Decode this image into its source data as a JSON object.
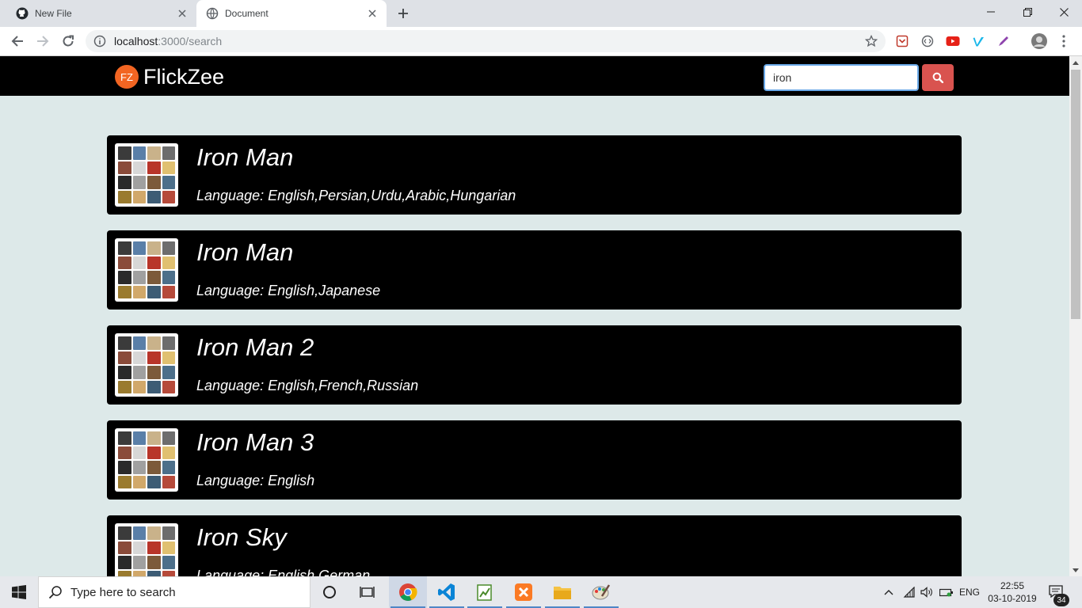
{
  "browser": {
    "tabs": [
      {
        "title": "New File",
        "icon": "github-icon",
        "active": false
      },
      {
        "title": "Document",
        "icon": "globe-icon",
        "active": true
      }
    ],
    "address": {
      "host": "localhost",
      "path": ":3000/search"
    }
  },
  "site": {
    "logo_badge": "FZ",
    "logo_text": "FlickZee",
    "search": {
      "value": "iron",
      "placeholder": ""
    }
  },
  "results": [
    {
      "title": "Iron Man",
      "language": "Language: English,Persian,Urdu,Arabic,Hungarian"
    },
    {
      "title": "Iron Man",
      "language": "Language: English,Japanese"
    },
    {
      "title": "Iron Man 2",
      "language": "Language: English,French,Russian"
    },
    {
      "title": "Iron Man 3",
      "language": "Language: English"
    },
    {
      "title": "Iron Sky",
      "language": "Language: English,German"
    }
  ],
  "taskbar": {
    "search_placeholder": "Type here to search",
    "language": "ENG",
    "time": "22:55",
    "date": "03-10-2019",
    "notification_count": "34"
  },
  "colors": {
    "page_bg": "#dde9e9",
    "header_bg": "#000000",
    "card_bg": "#000000",
    "search_button": "#d9534f",
    "logo_badge": "#f26522"
  }
}
